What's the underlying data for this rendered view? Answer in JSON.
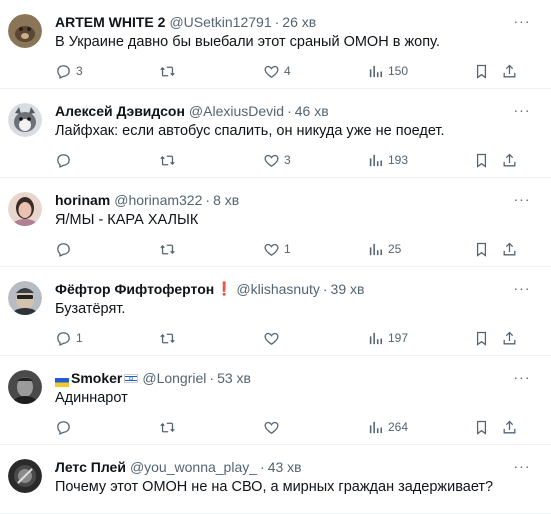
{
  "replies": [
    {
      "name": "ARTEM WHITE 2",
      "handle": "@USetkin12791",
      "time": "26 хв",
      "text": "В Украине давно бы выебали этот сраный ОМОН в жопу.",
      "replies": "3",
      "retweets": "",
      "likes": "4",
      "views": "150",
      "avatar_color": "#6b5a44"
    },
    {
      "name": "Алексей Дэвидсон",
      "handle": "@AlexiusDevid",
      "time": "46 хв",
      "text": "Лайфхак: если автобус спалить, он никуда уже не поедет.",
      "replies": "",
      "retweets": "",
      "likes": "3",
      "views": "193",
      "avatar_color": "#9aa0a6"
    },
    {
      "name": "horinam",
      "handle": "@horinam322",
      "time": "8 хв",
      "text": "Я/МЫ - КАРА ХАЛЫК",
      "replies": "",
      "retweets": "",
      "likes": "1",
      "views": "25",
      "avatar_color": "#c9a08c"
    },
    {
      "name": "Фёфтор Фифтофертон",
      "name_suffix": "❗",
      "handle": "@klishasnuty",
      "time": "39 хв",
      "text": "Бузатёрят.",
      "replies": "1",
      "retweets": "",
      "likes": "",
      "views": "197",
      "avatar_color": "#555b63"
    },
    {
      "name": "Smoker",
      "handle": "@Longriel",
      "time": "53 хв",
      "text": "Адиннарот",
      "replies": "",
      "retweets": "",
      "likes": "",
      "views": "264",
      "avatar_color": "#3b3b3b"
    },
    {
      "name": "Летс Плей",
      "handle": "@you_wonna_play_",
      "time": "43 хв",
      "text": "Почему этот ОМОН не на СВО, а мирных граждан задерживает?",
      "avatar_color": "#2a2a2a"
    }
  ],
  "colors": {
    "text": "#0f1419",
    "muted": "#536471",
    "divider": "#eff3f4",
    "alert": "#f4212e"
  },
  "icons": [
    "reply-icon",
    "retweet-icon",
    "like-icon",
    "views-icon",
    "bookmark-icon",
    "share-icon",
    "more-icon"
  ]
}
